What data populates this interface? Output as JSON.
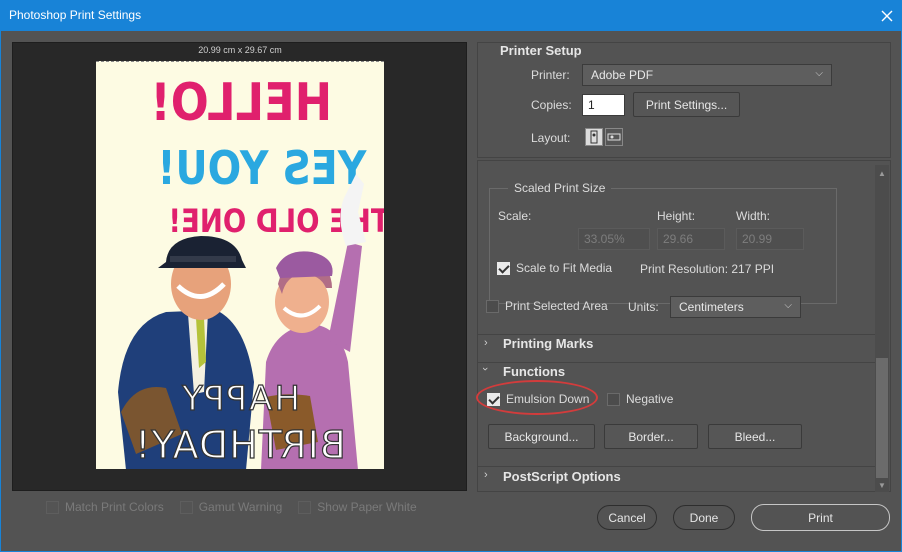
{
  "window": {
    "title": "Photoshop Print Settings"
  },
  "preview": {
    "paper_size": "20.99 cm x 29.67 cm"
  },
  "card": {
    "line1": "HELLO!",
    "line2": "YES YOU!",
    "line3": "THE OLD ONE!",
    "line4": "HAPPY",
    "line5": "BIRTHDAY!",
    "colors": {
      "pink": "#e0206d",
      "blue": "#2aa8e0",
      "white": "#ffffff"
    }
  },
  "bottom_checks": [
    {
      "label": "Match Print Colors"
    },
    {
      "label": "Gamut Warning"
    },
    {
      "label": "Show Paper White"
    }
  ],
  "printer_setup": {
    "heading": "Printer Setup",
    "printer_label": "Printer:",
    "printer_value": "Adobe PDF",
    "copies_label": "Copies:",
    "copies_value": "1",
    "print_settings_button": "Print Settings...",
    "layout_label": "Layout:"
  },
  "scaled_print_size": {
    "heading": "Scaled Print Size",
    "scale_label": "Scale:",
    "height_label": "Height:",
    "width_label": "Width:",
    "scale_value": "33.05%",
    "height_value": "29.66",
    "width_value": "20.99",
    "scale_to_fit_label": "Scale to Fit Media",
    "scale_to_fit_checked": true,
    "print_resolution": "Print Resolution: 217 PPI"
  },
  "print_selected_area": {
    "label": "Print Selected Area",
    "checked": false
  },
  "units": {
    "label": "Units:",
    "value": "Centimeters"
  },
  "sections": {
    "printing_marks": "Printing Marks",
    "functions": "Functions",
    "postscript_options": "PostScript Options"
  },
  "functions": {
    "emulsion_down_label": "Emulsion Down",
    "emulsion_down_checked": true,
    "negative_label": "Negative",
    "negative_checked": false,
    "background_button": "Background...",
    "border_button": "Border...",
    "bleed_button": "Bleed..."
  },
  "footer": {
    "cancel_button": "Cancel",
    "done_button": "Done",
    "print_button": "Print"
  },
  "colors": {
    "titlebar": "#1883d7",
    "dialog_bg": "#535353",
    "highlight_ellipse": "#d23c3c"
  }
}
